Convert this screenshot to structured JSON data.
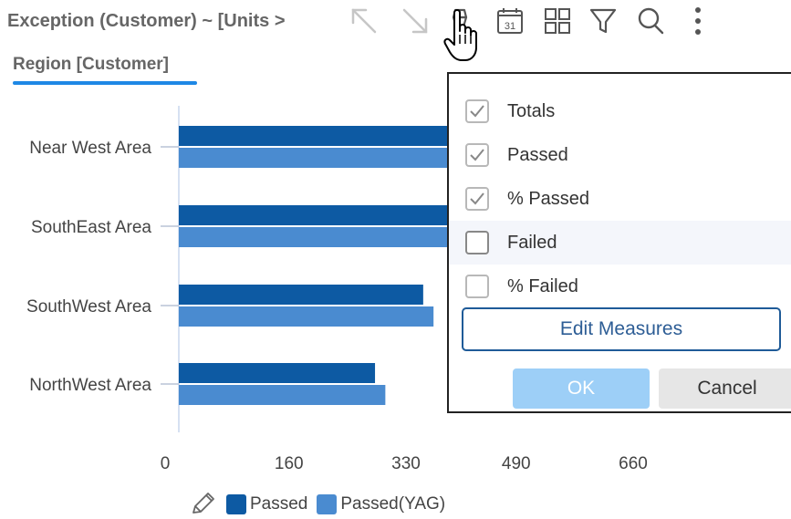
{
  "header": {
    "title": "Exception (Customer) ~ [Units >",
    "tab_label": "Region [Customer]"
  },
  "toolbar": {
    "tools": [
      {
        "name": "expand-icon"
      },
      {
        "name": "collapse-icon"
      },
      {
        "name": "highlighter-icon"
      },
      {
        "name": "calendar-icon",
        "text": "31"
      },
      {
        "name": "grid-icon"
      },
      {
        "name": "filter-icon"
      },
      {
        "name": "search-icon"
      },
      {
        "name": "more-vertical-icon"
      }
    ]
  },
  "colors": {
    "passed": "#0d5aa3",
    "passed_yag": "#4a8bd0",
    "accent": "#1e88e5",
    "ok_disabled": "#9dcff7"
  },
  "chart_data": {
    "type": "bar",
    "orientation": "horizontal",
    "categories": [
      "Near West Area",
      "SouthEast Area",
      "SouthWest Area",
      "NorthWest Area"
    ],
    "series": [
      {
        "name": "Passed",
        "values": [
          650,
          650,
          355,
          285
        ]
      },
      {
        "name": "Passed(YAG)",
        "values": [
          650,
          650,
          370,
          300
        ]
      }
    ],
    "x_ticks": [
      "0",
      "160",
      "330",
      "490",
      "660"
    ],
    "xlim": [
      0,
      660
    ],
    "grid": false,
    "legend_position": "bottom"
  },
  "popup": {
    "options": [
      {
        "label": "Totals",
        "checked": true
      },
      {
        "label": "Passed",
        "checked": true
      },
      {
        "label": "% Passed",
        "checked": true
      },
      {
        "label": "Failed",
        "checked": false
      },
      {
        "label": "% Failed",
        "checked": false
      }
    ],
    "edit_label": "Edit Measures",
    "ok_label": "OK",
    "cancel_label": "Cancel"
  }
}
